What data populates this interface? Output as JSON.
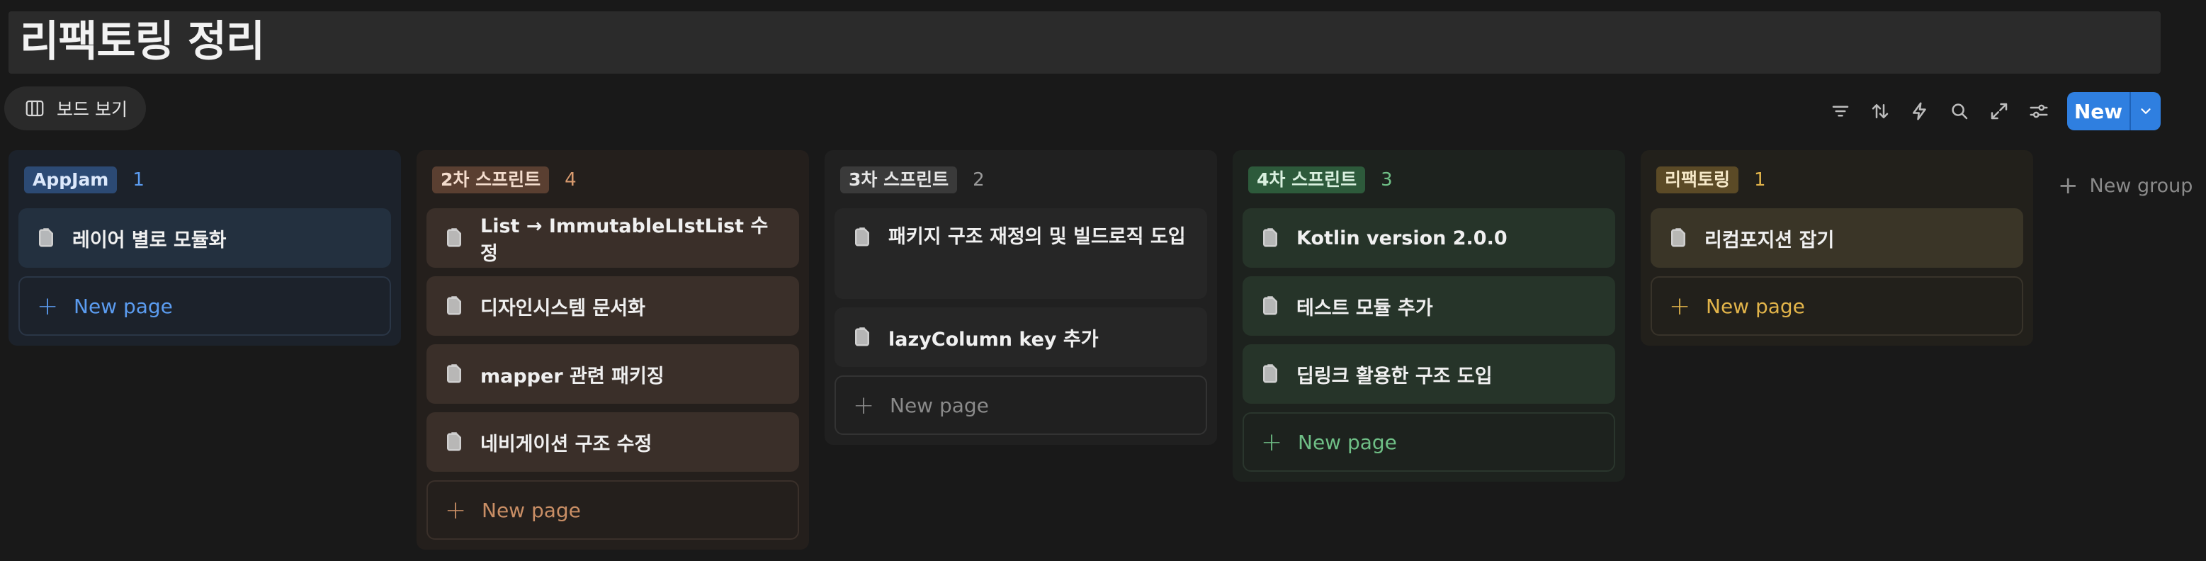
{
  "page": {
    "title": "리팩토링 정리"
  },
  "view": {
    "label": "보드 보기",
    "icon": "board-icon"
  },
  "toolbar": {
    "icons": [
      "filter-icon",
      "sort-icon",
      "automation-icon",
      "search-icon",
      "expand-icon",
      "settings-icon"
    ],
    "new_label": "New"
  },
  "columns": [
    {
      "tag": "AppJam",
      "count": "1",
      "colors": {
        "bg": "#1c222b",
        "tag_bg": "#2c4a74",
        "tag_fg": "#dce8fb",
        "count": "#5b9cf0",
        "card": "#23303f",
        "new": "#5b9cf0",
        "new_border": "#2a3646"
      },
      "cards": [
        "레이어 별로 모듈화"
      ],
      "new_page": "New page"
    },
    {
      "tag": "2차 스프린트",
      "count": "4",
      "colors": {
        "bg": "#241f1c",
        "tag_bg": "#5a3f31",
        "tag_fg": "#f4dccd",
        "count": "#d89a6e",
        "card": "#3a2f29",
        "new": "#c98e65",
        "new_border": "#3a302a"
      },
      "cards": [
        "List → ImmutableLIstList 수정",
        "디자인시스템 문서화",
        "mapper 관련 패키징",
        "네비게이션 구조 수정"
      ],
      "new_page": "New page"
    },
    {
      "tag": "3차 스프린트",
      "count": "2",
      "colors": {
        "bg": "#202020",
        "tag_bg": "#3a3a3a",
        "tag_fg": "#e6e6e6",
        "count": "#9a9a9a",
        "card": "#262626",
        "new": "#8a8a8a",
        "new_border": "#333333"
      },
      "cards": [
        "패키지 구조 재정의 및 빌드로직 도입",
        "lazyColumn key 추가"
      ],
      "new_page": "New page"
    },
    {
      "tag": "4차 스프린트",
      "count": "3",
      "colors": {
        "bg": "#1d221e",
        "tag_bg": "#2d5a3b",
        "tag_fg": "#d9f0df",
        "count": "#6fbf86",
        "card": "#263429",
        "new": "#6fbf86",
        "new_border": "#2a362d"
      },
      "cards": [
        "Kotlin version 2.0.0",
        "테스트 모듈 추가",
        "딥링크 활용한 구조 도입"
      ],
      "new_page": "New page"
    },
    {
      "tag": "리팩토링",
      "count": "1",
      "colors": {
        "bg": "#22201b",
        "tag_bg": "#5b4a26",
        "tag_fg": "#f5e8c8",
        "count": "#e2b44a",
        "card": "#3a3527",
        "new": "#e2b44a",
        "new_border": "#38332a"
      },
      "cards": [
        "리컴포지션 잡기"
      ],
      "new_page": "New page"
    }
  ],
  "new_group": {
    "label": "New group"
  }
}
